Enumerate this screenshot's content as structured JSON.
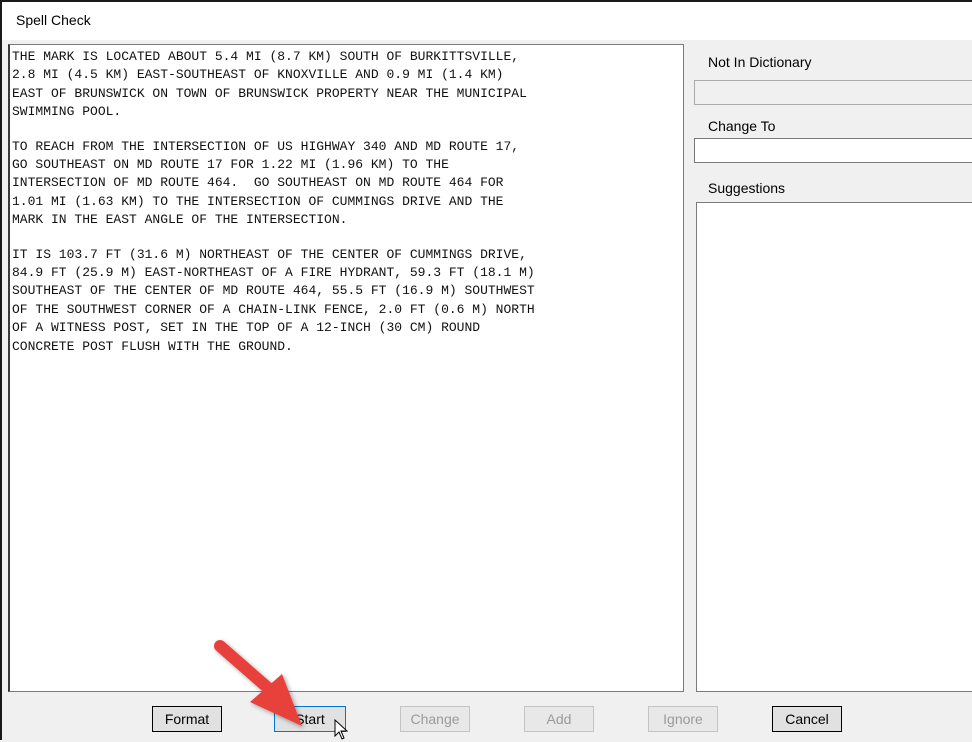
{
  "window": {
    "title": "Spell Check"
  },
  "document": {
    "paragraphs": [
      "THE MARK IS LOCATED ABOUT 5.4 MI (8.7 KM) SOUTH OF BURKITTSVILLE,\n2.8 MI (4.5 KM) EAST-SOUTHEAST OF KNOXVILLE AND 0.9 MI (1.4 KM)\nEAST OF BRUNSWICK ON TOWN OF BRUNSWICK PROPERTY NEAR THE MUNICIPAL\nSWIMMING POOL.",
      "TO REACH FROM THE INTERSECTION OF US HIGHWAY 340 AND MD ROUTE 17,\nGO SOUTHEAST ON MD ROUTE 17 FOR 1.22 MI (1.96 KM) TO THE\nINTERSECTION OF MD ROUTE 464.  GO SOUTHEAST ON MD ROUTE 464 FOR\n1.01 MI (1.63 KM) TO THE INTERSECTION OF CUMMINGS DRIVE AND THE\nMARK IN THE EAST ANGLE OF THE INTERSECTION.",
      "IT IS 103.7 FT (31.6 M) NORTHEAST OF THE CENTER OF CUMMINGS DRIVE,\n84.9 FT (25.9 M) EAST-NORTHEAST OF A FIRE HYDRANT, 59.3 FT (18.1 M)\nSOUTHEAST OF THE CENTER OF MD ROUTE 464, 55.5 FT (16.9 M) SOUTHWEST\nOF THE SOUTHWEST CORNER OF A CHAIN-LINK FENCE, 2.0 FT (0.6 M) NORTH\nOF A WITNESS POST, SET IN THE TOP OF A 12-INCH (30 CM) ROUND\nCONCRETE POST FLUSH WITH THE GROUND."
    ]
  },
  "panel": {
    "not_in_dictionary_label": "Not In Dictionary",
    "not_in_dictionary_value": "",
    "change_to_label": "Change To",
    "change_to_value": "",
    "suggestions_label": "Suggestions"
  },
  "buttons": {
    "format": "Format",
    "start": "Start",
    "change": "Change",
    "add": "Add",
    "ignore": "Ignore",
    "cancel": "Cancel"
  },
  "annotation": {
    "arrow_color": "#e8413a"
  }
}
